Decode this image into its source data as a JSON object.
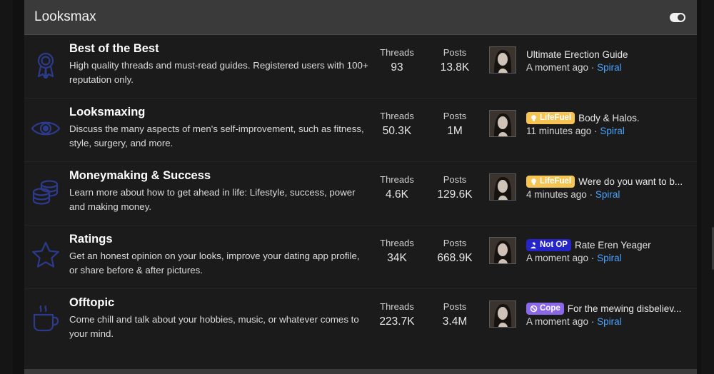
{
  "section": {
    "title": "Looksmax"
  },
  "colors": {
    "accent_link": "#4aa3ff",
    "icon_color": "#2d3a8c",
    "header_bg": "#3a3a3a",
    "lifefuel": "#f6c453",
    "not_op": "#2424c8",
    "cope": "#8a68e8"
  },
  "forums": [
    {
      "name": "Best of the Best",
      "icon": "award-ribbon-icon",
      "desc": "High quality threads and must-read guides. Registered users with 100+ reputation only.",
      "threads_label": "Threads",
      "threads": "93",
      "posts_label": "Posts",
      "posts": "13.8K",
      "latest": {
        "prefix": "",
        "title": "Ultimate Erection Guide",
        "time": "A moment ago",
        "sep": "·",
        "user": "Spiral"
      }
    },
    {
      "name": "Looksmaxing",
      "icon": "eye-icon",
      "desc": "Discuss the many aspects of men's self-improvement, such as fitness, style, surgery, and more.",
      "threads_label": "Threads",
      "threads": "50.3K",
      "posts_label": "Posts",
      "posts": "1M",
      "latest": {
        "prefix": "LifeFuel",
        "prefix_type": "lifefuel",
        "title": "Body & Halos.",
        "time": "11 minutes ago",
        "sep": "·",
        "user": "Spiral"
      }
    },
    {
      "name": "Moneymaking & Success",
      "icon": "coins-icon",
      "desc": "Learn more about how to get ahead in life: Lifestyle, success, power and making money.",
      "threads_label": "Threads",
      "threads": "4.6K",
      "posts_label": "Posts",
      "posts": "129.6K",
      "latest": {
        "prefix": "LifeFuel",
        "prefix_type": "lifefuel",
        "title": "Were do you want to b...",
        "time": "4 minutes ago",
        "sep": "·",
        "user": "Spiral"
      }
    },
    {
      "name": "Ratings",
      "icon": "star-icon",
      "desc": "Get an honest opinion on your looks, improve your dating app profile, or share before & after pictures.",
      "threads_label": "Threads",
      "threads": "34K",
      "posts_label": "Posts",
      "posts": "668.9K",
      "latest": {
        "prefix": "Not OP",
        "prefix_type": "notop",
        "title": "Rate Eren Yeager",
        "time": "A moment ago",
        "sep": "·",
        "user": "Spiral"
      }
    },
    {
      "name": "Offtopic",
      "icon": "coffee-cup-icon",
      "desc": "Come chill and talk about your hobbies, music, or whatever comes to your mind.",
      "threads_label": "Threads",
      "threads": "223.7K",
      "posts_label": "Posts",
      "posts": "3.4M",
      "latest": {
        "prefix": "Cope",
        "prefix_type": "cope",
        "title": "For the mewing disbeliev...",
        "time": "A moment ago",
        "sep": "·",
        "user": "Spiral"
      }
    }
  ]
}
